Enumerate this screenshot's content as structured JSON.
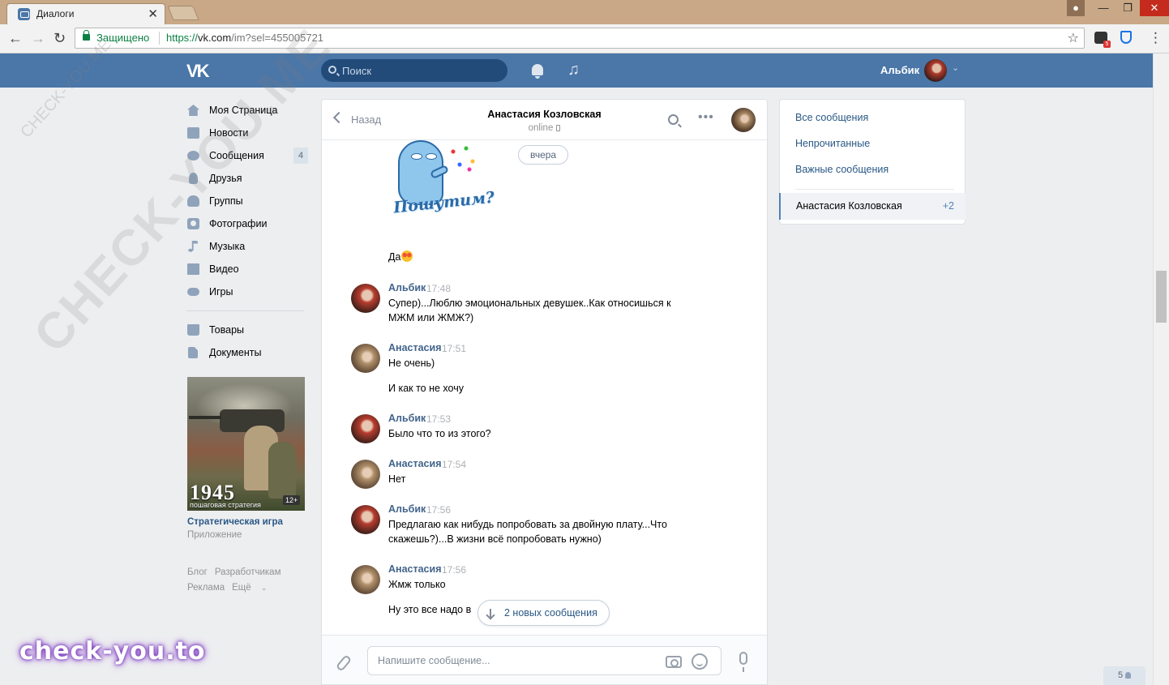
{
  "browser": {
    "tab_title": "Диалоги",
    "tab_close": "✕",
    "secure_label": "Защищено",
    "url_prefix": "https://",
    "url_host": "vk.com",
    "url_rest": "/im?sel=455005721",
    "ext_badge": "5"
  },
  "header": {
    "search_placeholder": "Поиск",
    "user_name": "Альбик"
  },
  "sidebar": {
    "items": [
      {
        "label": "Моя Страница",
        "icon": "home-icon"
      },
      {
        "label": "Новости",
        "icon": "news-icon"
      },
      {
        "label": "Сообщения",
        "icon": "messages-icon",
        "badge": "4"
      },
      {
        "label": "Друзья",
        "icon": "friends-icon"
      },
      {
        "label": "Группы",
        "icon": "groups-icon"
      },
      {
        "label": "Фотографии",
        "icon": "photo-icon"
      },
      {
        "label": "Музыка",
        "icon": "music-icon"
      },
      {
        "label": "Видео",
        "icon": "video-icon"
      },
      {
        "label": "Игры",
        "icon": "games-icon"
      }
    ],
    "items2": [
      {
        "label": "Товары",
        "icon": "goods-icon"
      },
      {
        "label": "Документы",
        "icon": "documents-icon"
      }
    ],
    "ad": {
      "year": "1945",
      "subtitle": "пошаговая стратегия",
      "age": "12+",
      "title": "Стратегическая игра",
      "type": "Приложение"
    },
    "footer": {
      "blog": "Блог",
      "developers": "Разработчикам",
      "ads": "Реклама",
      "more": "Ещё"
    }
  },
  "chat": {
    "back_label": "Назад",
    "peer_name": "Анастасия Козловская",
    "peer_status": "online",
    "date_pill": "вчера",
    "sticker_text": "Пошутим?",
    "first_text": "Да",
    "groups": [
      {
        "author": "Альбик",
        "time": "17:48",
        "avatar": "a",
        "lines": [
          "Супер)...Люблю эмоциональных девушек..Как относишься к",
          "МЖМ или ЖМЖ?)"
        ]
      },
      {
        "author": "Анастасия",
        "time": "17:51",
        "avatar": "b",
        "lines": [
          "Не очень)"
        ],
        "extra": "И как то не хочу"
      },
      {
        "author": "Альбик",
        "time": "17:53",
        "avatar": "a",
        "lines": [
          "Было что то из этого?"
        ]
      },
      {
        "author": "Анастасия",
        "time": "17:54",
        "avatar": "b",
        "lines": [
          "Нет"
        ]
      },
      {
        "author": "Альбик",
        "time": "17:56",
        "avatar": "a",
        "lines": [
          "Предлагаю как нибудь попробовать за двойную плату...Что",
          "скажешь?)...В жизни всё попробовать нужно)"
        ]
      },
      {
        "author": "Анастасия",
        "time": "17:56",
        "avatar": "b",
        "lines": [
          "Жмж только"
        ],
        "extra": "Ну это все надо в"
      }
    ],
    "new_messages": "2 новых сообщения",
    "composer_placeholder": "Напишите сообщение..."
  },
  "right_panel": {
    "all": "Все сообщения",
    "unread": "Непрочитанные",
    "important": "Важные сообщения",
    "active_name": "Анастасия Козловская",
    "active_count": "+2"
  },
  "online_count": "5",
  "watermark": {
    "diagonal": "CHECK-YOU.ME",
    "small": "CHECK-YOU.ME",
    "logo": "check-you.to"
  }
}
